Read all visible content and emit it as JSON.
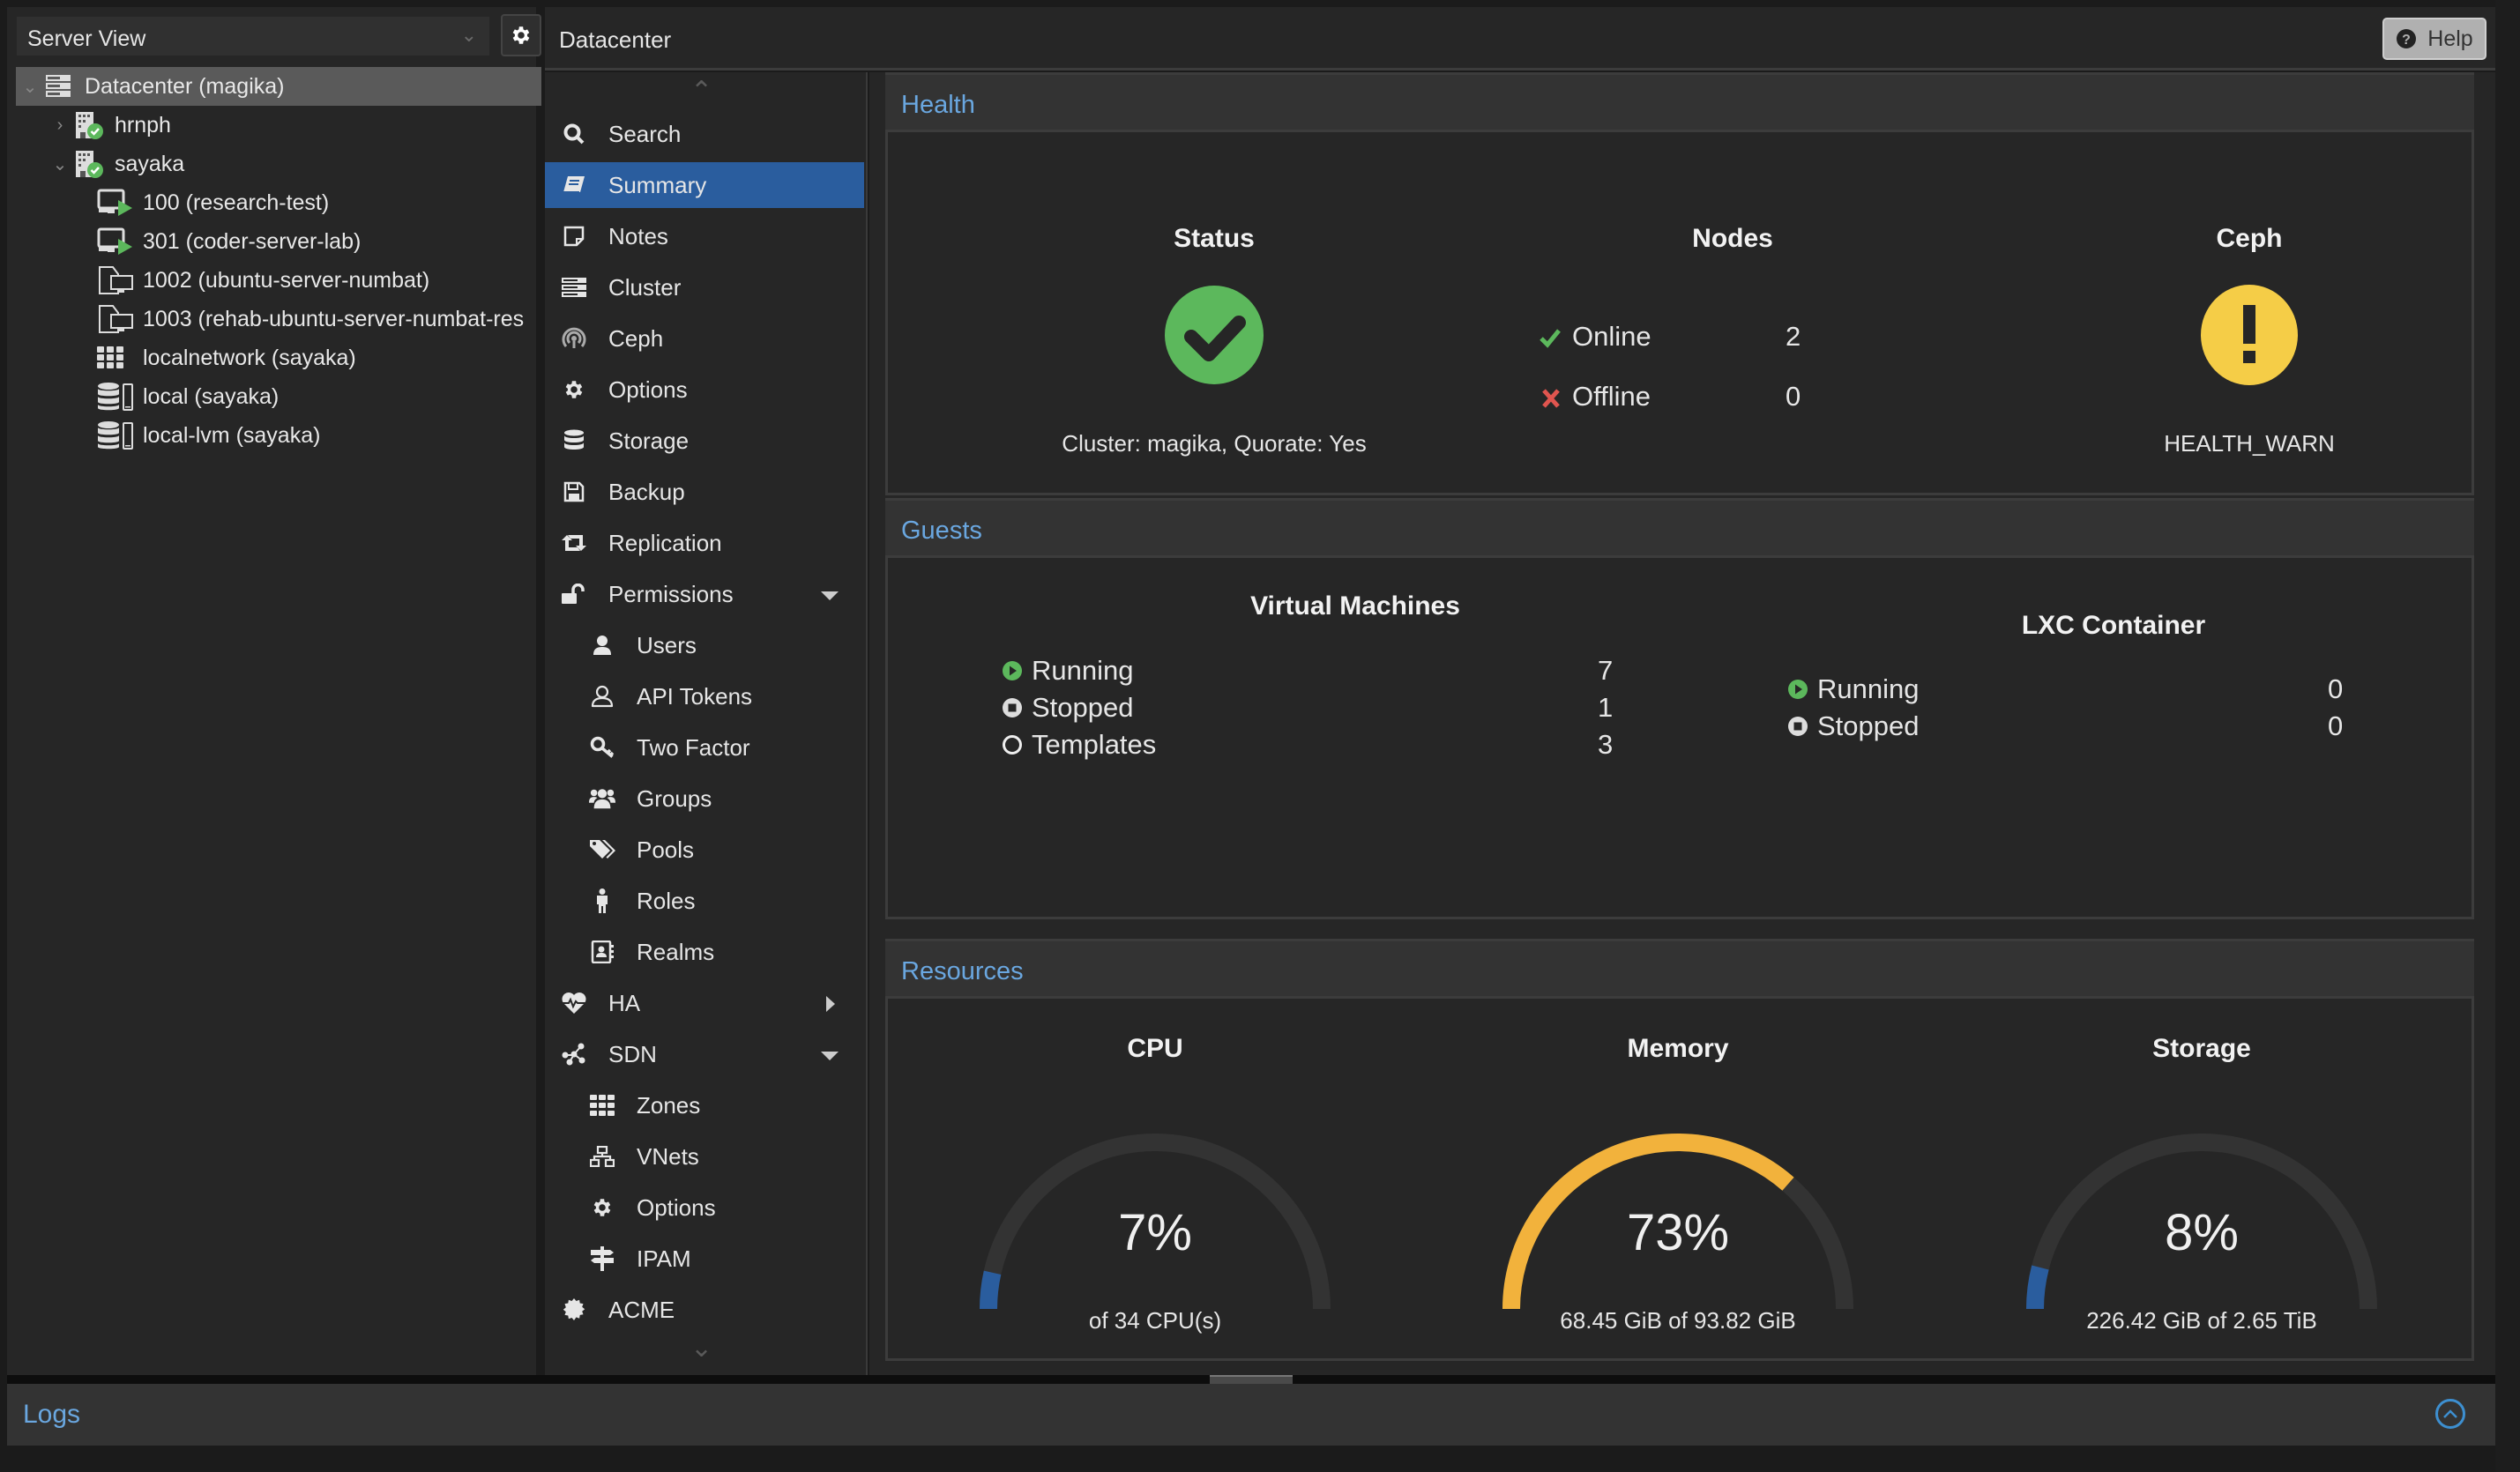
{
  "left_panel": {
    "view_selector": "Server View",
    "tree": [
      {
        "label": "Datacenter (magika)",
        "icon": "datacenter-icon",
        "level": 0,
        "expanded": true,
        "selected": true
      },
      {
        "label": "hrnph",
        "icon": "node-online-icon",
        "level": 1,
        "expanded": false
      },
      {
        "label": "sayaka",
        "icon": "node-online-icon",
        "level": 1,
        "expanded": true
      },
      {
        "label": "100 (research-test)",
        "icon": "vm-running-icon",
        "level": 2
      },
      {
        "label": "301 (coder-server-lab)",
        "icon": "vm-running-icon",
        "level": 2
      },
      {
        "label": "1002 (ubuntu-server-numbat)",
        "icon": "vm-template-icon",
        "level": 2
      },
      {
        "label": "1003 (rehab-ubuntu-server-numbat-res",
        "icon": "vm-template-icon",
        "level": 2
      },
      {
        "label": "localnetwork (sayaka)",
        "icon": "sdn-zone-icon",
        "level": 2
      },
      {
        "label": "local (sayaka)",
        "icon": "storage-icon",
        "level": 2
      },
      {
        "label": "local-lvm (sayaka)",
        "icon": "storage-icon",
        "level": 2
      }
    ]
  },
  "header": {
    "title": "Datacenter",
    "help_label": "Help"
  },
  "nav": {
    "items": [
      {
        "label": "Search",
        "icon": "search-icon"
      },
      {
        "label": "Summary",
        "icon": "book-icon",
        "active": true
      },
      {
        "label": "Notes",
        "icon": "notes-icon"
      },
      {
        "label": "Cluster",
        "icon": "server-icon"
      },
      {
        "label": "Ceph",
        "icon": "ceph-icon"
      },
      {
        "label": "Options",
        "icon": "gear-icon"
      },
      {
        "label": "Storage",
        "icon": "database-icon"
      },
      {
        "label": "Backup",
        "icon": "floppy-icon"
      },
      {
        "label": "Replication",
        "icon": "retweet-icon"
      },
      {
        "label": "Permissions",
        "icon": "unlock-icon",
        "caret": "down"
      },
      {
        "label": "Users",
        "icon": "user-icon",
        "sub": true
      },
      {
        "label": "API Tokens",
        "icon": "user-outline-icon",
        "sub": true
      },
      {
        "label": "Two Factor",
        "icon": "key-icon",
        "sub": true
      },
      {
        "label": "Groups",
        "icon": "users-icon",
        "sub": true
      },
      {
        "label": "Pools",
        "icon": "tags-icon",
        "sub": true
      },
      {
        "label": "Roles",
        "icon": "male-icon",
        "sub": true
      },
      {
        "label": "Realms",
        "icon": "address-book-icon",
        "sub": true
      },
      {
        "label": "HA",
        "icon": "heartbeat-icon",
        "caret": "right"
      },
      {
        "label": "SDN",
        "icon": "sdn-icon",
        "caret": "down"
      },
      {
        "label": "Zones",
        "icon": "th-icon",
        "sub": true
      },
      {
        "label": "VNets",
        "icon": "network-icon",
        "sub": true
      },
      {
        "label": "Options",
        "icon": "gear-icon",
        "sub": true
      },
      {
        "label": "IPAM",
        "icon": "signpost-icon",
        "sub": true
      },
      {
        "label": "ACME",
        "icon": "certificate-icon"
      }
    ]
  },
  "health": {
    "title": "Health",
    "status": {
      "title": "Status",
      "state": "ok",
      "text": "Cluster: magika, Quorate: Yes"
    },
    "nodes": {
      "title": "Nodes",
      "online_label": "Online",
      "online": "2",
      "offline_label": "Offline",
      "offline": "0"
    },
    "ceph": {
      "title": "Ceph",
      "state": "warn",
      "text": "HEALTH_WARN"
    }
  },
  "guests": {
    "title": "Guests",
    "vms": {
      "title": "Virtual Machines",
      "rows": [
        {
          "label": "Running",
          "value": "7",
          "icon": "running-icon"
        },
        {
          "label": "Stopped",
          "value": "1",
          "icon": "stopped-icon"
        },
        {
          "label": "Templates",
          "value": "3",
          "icon": "template-icon"
        }
      ]
    },
    "lxc": {
      "title": "LXC Container",
      "rows": [
        {
          "label": "Running",
          "value": "0",
          "icon": "running-icon"
        },
        {
          "label": "Stopped",
          "value": "0",
          "icon": "stopped-icon"
        }
      ]
    }
  },
  "resources": {
    "title": "Resources",
    "gauges": [
      {
        "title": "CPU",
        "percent": 7,
        "value_text": "7%",
        "sub": "of 34 CPU(s)",
        "color": "#2a5d9e"
      },
      {
        "title": "Memory",
        "percent": 73,
        "value_text": "73%",
        "sub": "68.45 GiB of 93.82 GiB",
        "color": "#f2b23c"
      },
      {
        "title": "Storage",
        "percent": 8,
        "value_text": "8%",
        "sub": "226.42 GiB of 2.65 TiB",
        "color": "#2a5d9e"
      }
    ]
  },
  "logs": {
    "title": "Logs"
  },
  "colors": {
    "accent": "#2a5d9e",
    "link_blue": "#6aa7e0",
    "ok_green": "#5cb85c",
    "warn_yellow": "#f5cd47",
    "error_red": "#e0554f",
    "memory_orange": "#f2b23c"
  }
}
